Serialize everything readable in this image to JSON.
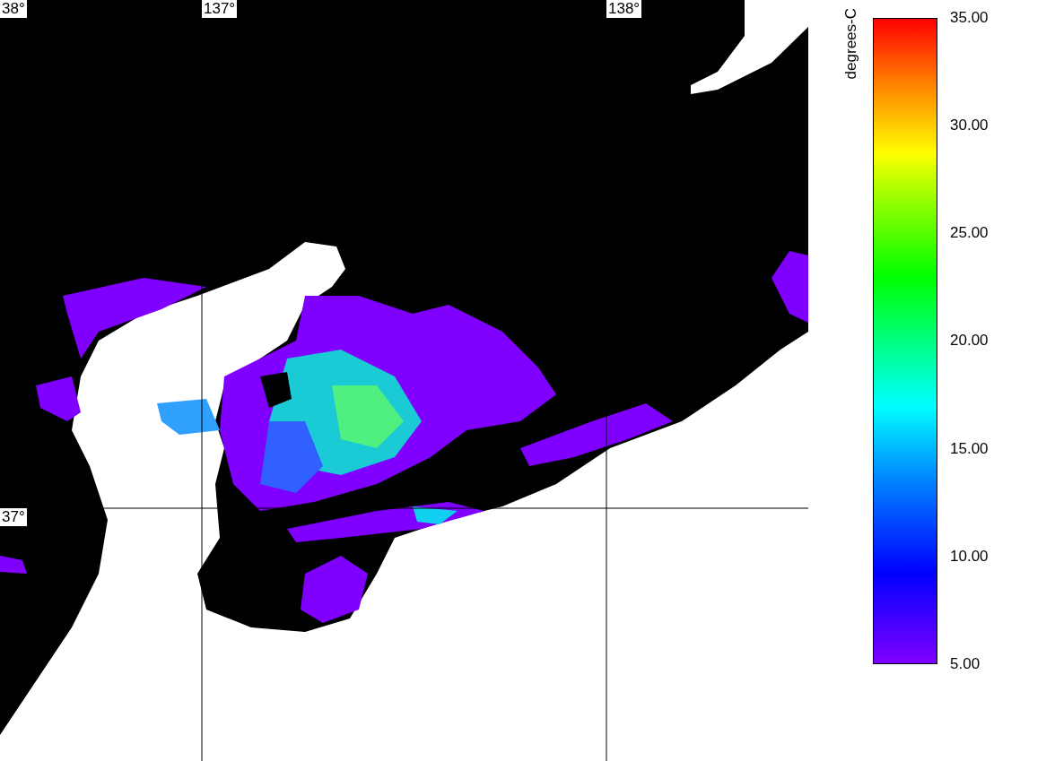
{
  "map": {
    "lon_labels": [
      "137°",
      "138°"
    ],
    "lat_labels": [
      "38°",
      "37°"
    ]
  },
  "colorbar": {
    "label": "degrees-C",
    "ticks": [
      "35.00",
      "30.00",
      "25.00",
      "20.00",
      "15.00",
      "10.00",
      "5.00"
    ]
  }
}
